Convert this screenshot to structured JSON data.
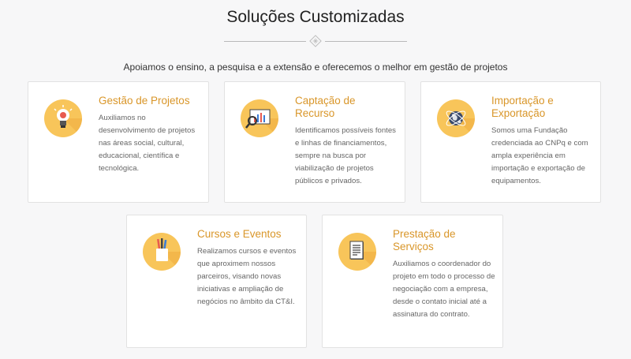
{
  "header": {
    "title": "Soluções Customizadas",
    "subtitle": "Apoiamos o ensino, a pesquisa e a extensão e oferecemos o melhor em gestão de projetos"
  },
  "cards": [
    {
      "icon": "lightbulb-icon",
      "title": "Gestão de Projetos",
      "description": "Auxiliamos no desenvolvimento de projetos nas áreas social, cultural, educacional, científica e tecnológica."
    },
    {
      "icon": "magnifier-chart-icon",
      "title": "Captação de Recurso",
      "description": "Identificamos possíveis fontes e linhas de financiamentos, sempre na busca por viabilização de projetos públicos e privados."
    },
    {
      "icon": "globe-icon",
      "title": "Importação e Exportação",
      "description": "Somos uma Fundação credenciada ao CNPq e com ampla experiência em importação e exportação de equipamentos."
    },
    {
      "icon": "pencil-cup-icon",
      "title": "Cursos e Eventos",
      "description": "Realizamos cursos e eventos que aproximem nossos parceiros, visando novas iniciativas e ampliação de negócios no âmbito da CT&I."
    },
    {
      "icon": "document-icon",
      "title": "Prestação de Serviços",
      "description": "Auxiliamos o coordenador do projeto em todo o processo de negociação com a empresa, desde o contato inicial até a assinatura do contrato."
    }
  ],
  "colors": {
    "accent": "#d99629",
    "icon_bg": "#f8c55a",
    "background": "#f7f7f8"
  }
}
